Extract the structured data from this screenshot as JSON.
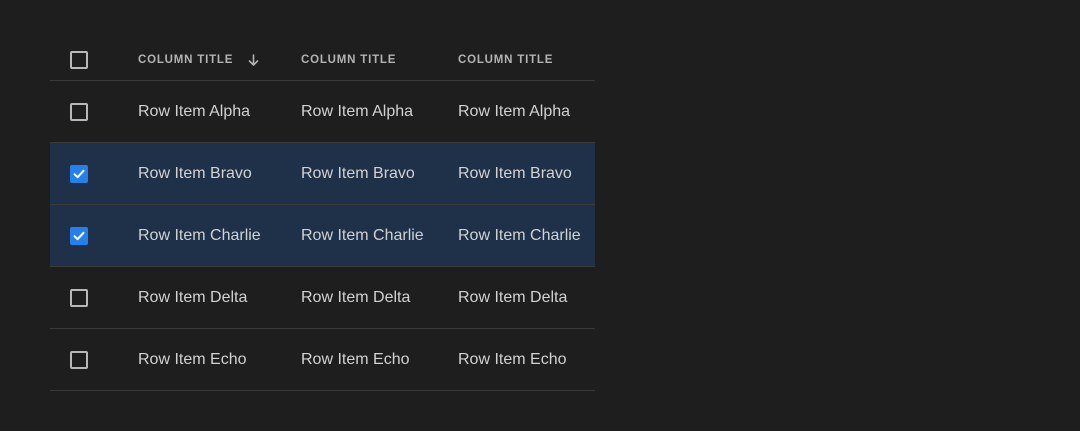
{
  "table": {
    "columns": [
      {
        "title": "COLUMN TITLE",
        "sort": "descending"
      },
      {
        "title": "COLUMN TITLE"
      },
      {
        "title": "COLUMN TITLE"
      }
    ],
    "header_checked": false,
    "rows": [
      {
        "cells": [
          "Row Item Alpha",
          "Row Item Alpha",
          "Row Item Alpha"
        ],
        "selected": false
      },
      {
        "cells": [
          "Row Item Bravo",
          "Row Item Bravo",
          "Row Item Bravo"
        ],
        "selected": true
      },
      {
        "cells": [
          "Row Item Charlie",
          "Row Item Charlie",
          "Row Item Charlie"
        ],
        "selected": true
      },
      {
        "cells": [
          "Row Item Delta",
          "Row Item Delta",
          "Row Item Delta"
        ],
        "selected": false
      },
      {
        "cells": [
          "Row Item Echo",
          "Row Item Echo",
          "Row Item Echo"
        ],
        "selected": false
      }
    ]
  },
  "colors": {
    "background": "#1e1e1e",
    "selected_row": "#1f3049",
    "accent": "#2680eb",
    "divider": "#3a3a3a"
  },
  "icons": {
    "sort": "arrow-down-icon",
    "check": "checkmark-icon"
  }
}
